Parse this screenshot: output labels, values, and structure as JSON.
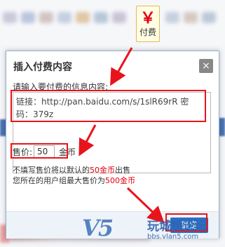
{
  "toolbar": {
    "pay_button": {
      "icon": "yen-icon",
      "symbol": "￥",
      "label": "付费"
    }
  },
  "dialog": {
    "title": "插入付费内容",
    "close_symbol": "×",
    "prompt": "请输入要付费的信息内容:",
    "content_value": "链接：http://pan.baidu.com/s/1slR69rR 密码：379z",
    "price_label": "售价:",
    "price_value": "50",
    "price_unit": "金币",
    "hint1_prefix": "不填写售价将以默认的",
    "hint1_highlight": "50金币",
    "hint1_suffix": "出售",
    "hint2_prefix": "您所在的用户组最大售价为",
    "hint2_highlight": "500金币",
    "ok_label": "确定"
  },
  "watermark": {
    "logo": "V5",
    "name": "玩城狮论坛",
    "url": "bbs.vlan5.com"
  },
  "colors": {
    "annotation": "#e8141c",
    "highlight": "#e60012",
    "primary": "#2d6ec4"
  }
}
